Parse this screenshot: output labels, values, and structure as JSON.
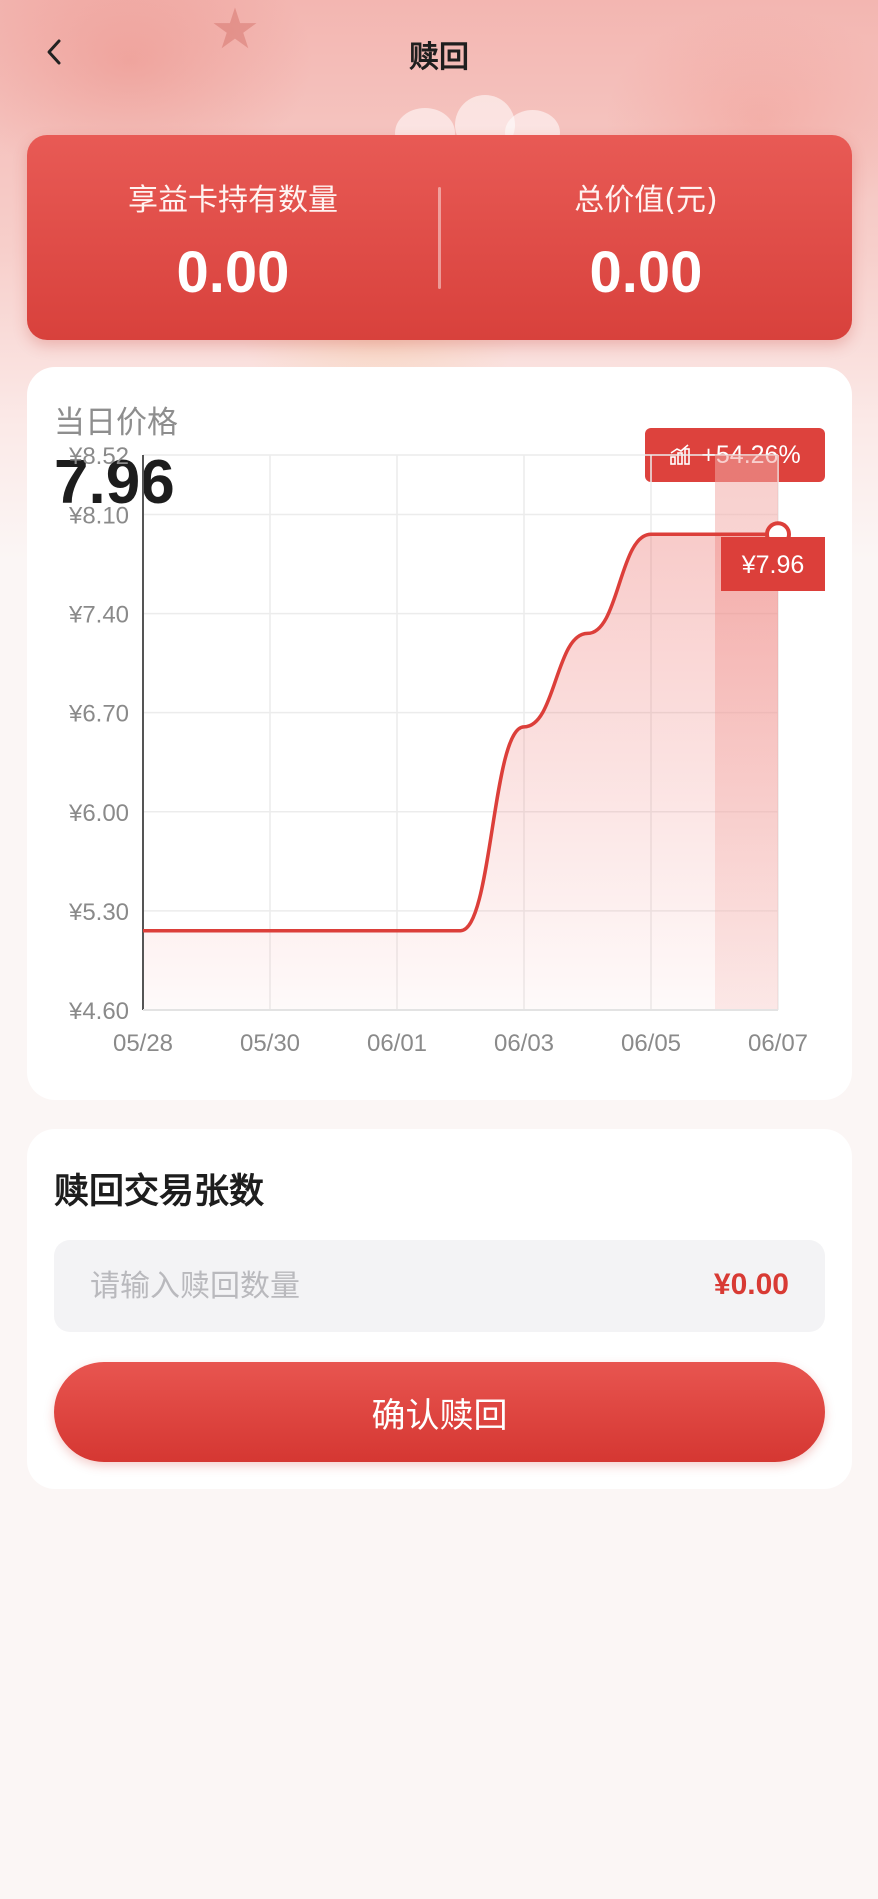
{
  "nav": {
    "title": "赎回"
  },
  "stats": {
    "holdings_label": "享益卡持有数量",
    "holdings_value": "0.00",
    "total_label": "总价值(元)",
    "total_value": "0.00"
  },
  "price": {
    "label": "当日价格",
    "value": "7.96",
    "change": "+54.26%"
  },
  "chart_data": {
    "type": "line",
    "x": [
      "05/28",
      "05/29",
      "05/30",
      "05/31",
      "06/01",
      "06/02",
      "06/03",
      "06/04",
      "06/05",
      "06/06",
      "06/07"
    ],
    "series": [
      {
        "values": [
          5.16,
          5.16,
          5.16,
          5.16,
          5.16,
          5.16,
          6.6,
          7.26,
          7.96,
          7.96,
          7.96
        ]
      }
    ],
    "xtick_labels": [
      "05/28",
      "05/30",
      "06/01",
      "06/03",
      "06/05",
      "06/07"
    ],
    "ytick_labels": [
      "¥4.60",
      "¥5.30",
      "¥6.00",
      "¥6.70",
      "¥7.40",
      "¥8.10",
      "¥8.52"
    ],
    "yticks": [
      4.6,
      5.3,
      6.0,
      6.7,
      7.4,
      8.1,
      8.52
    ],
    "ylim": [
      4.6,
      8.52
    ],
    "grid": true,
    "tooltip": "¥7.96",
    "color": "#dc3f3a"
  },
  "redeem": {
    "title": "赎回交易张数",
    "input_placeholder": "请输入赎回数量",
    "amount": "¥0.00",
    "confirm_label": "确认赎回"
  },
  "colors": {
    "accent": "#dd423d",
    "accent_dark": "#d53732",
    "background": "#fbf6f5"
  }
}
